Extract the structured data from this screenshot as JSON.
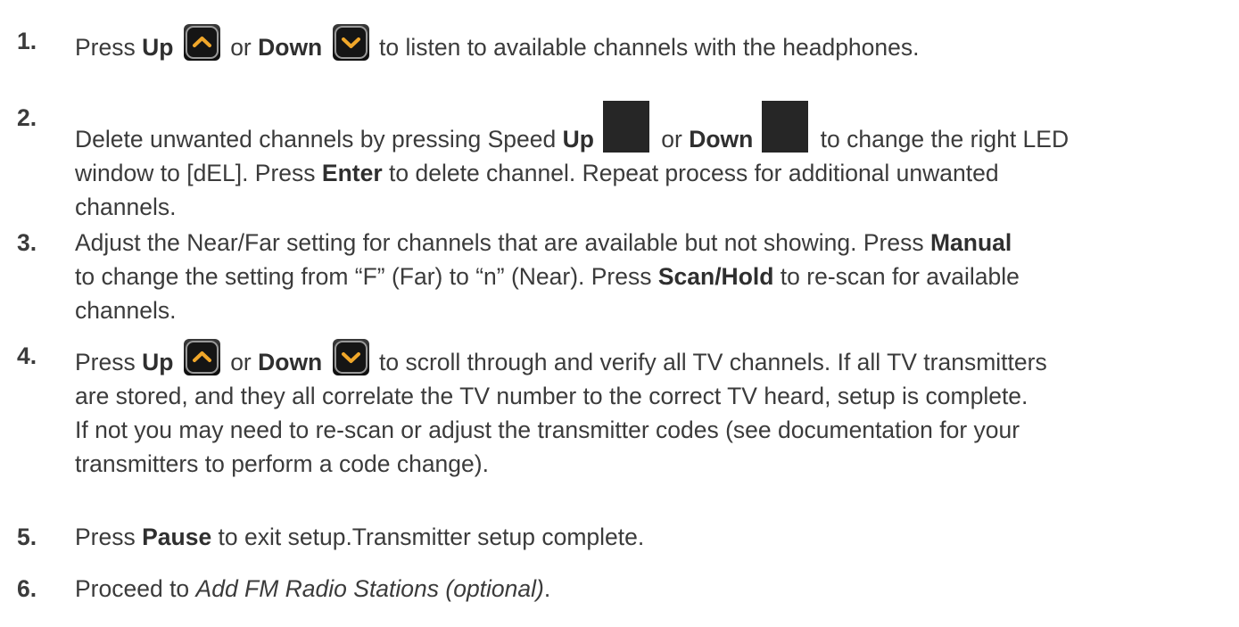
{
  "steps": [
    {
      "num": "1.",
      "t1": "Press ",
      "b1": "Up",
      "t2": " or ",
      "b2": "Down",
      "t3": " to listen to available channels with the headphones."
    },
    {
      "num": "2.",
      "t1": "Delete unwanted channels by pressing Speed ",
      "b1": "Up",
      "t2": " or ",
      "b2": "Down",
      "t3": " to change the right LED",
      "line2a": "window to [dEL]. Press ",
      "line2b": "Enter",
      "line2c": " to delete channel. Repeat process for additional unwanted",
      "line3": "channels."
    },
    {
      "num": "3.",
      "line1a": "Adjust the Near/Far setting for channels that are available but not showing. Press ",
      "line1b": "Manual",
      "line2a": "to change the setting from “F” (Far) to “n” (Near). Press ",
      "line2b": "Scan/Hold",
      "line2c": " to re-scan for available",
      "line3": "channels."
    },
    {
      "num": "4.",
      "t1": "Press ",
      "b1": "Up",
      "t2": " or ",
      "b2": "Down",
      "t3": " to scroll through and verify all TV channels. If all TV transmitters",
      "line2": "are stored, and they all correlate the TV number to the correct TV heard, setup is complete.",
      "line3": "If not you may need to re-scan or adjust the transmitter codes (see documentation for your",
      "line4": "transmitters to perform a code change)."
    },
    {
      "num": "5.",
      "t1": "Press ",
      "b1": "Pause",
      "t2": " to exit setup.Transmitter setup complete."
    },
    {
      "num": "6.",
      "t1": "Proceed to ",
      "i1": "Add FM Radio Stations (optional)",
      "t2": "."
    }
  ],
  "icons": {
    "up": "chevron-up-button-icon",
    "down": "chevron-down-button-icon",
    "speed": "speed-button-icon"
  },
  "colors": {
    "text": "#3b3b3b",
    "chevron": "#f0a72a",
    "button": "#1a1a1a"
  }
}
